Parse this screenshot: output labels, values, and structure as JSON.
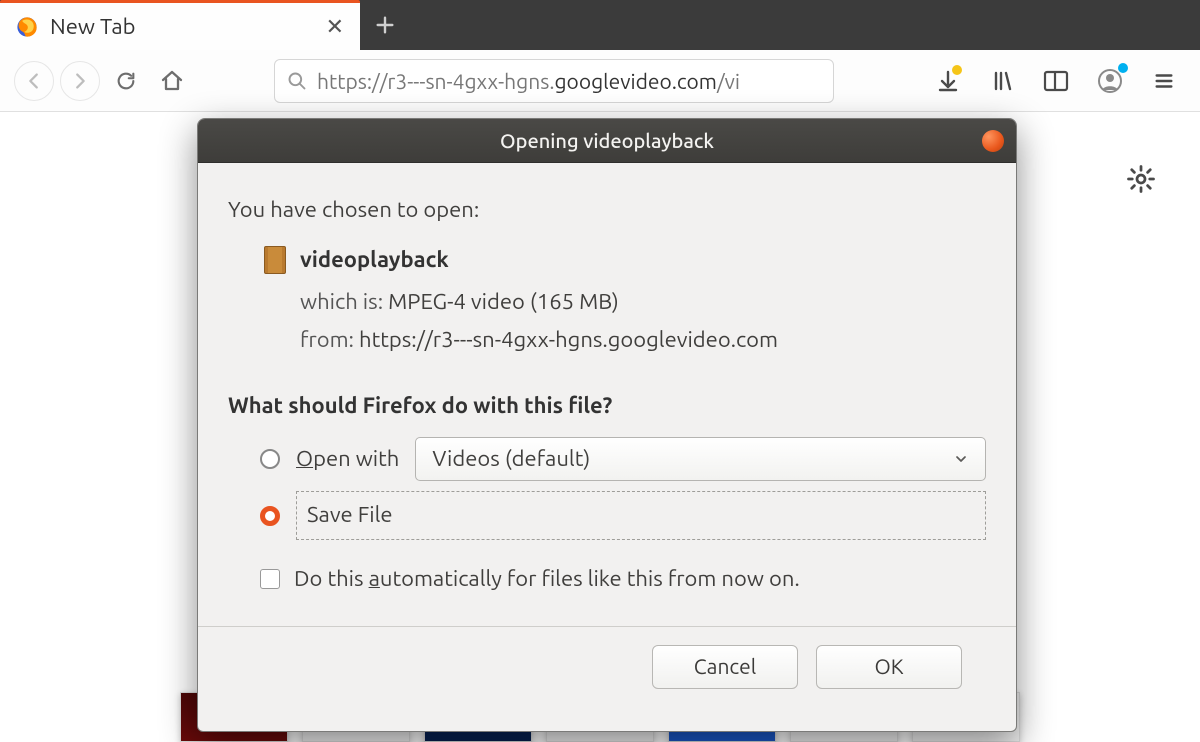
{
  "tab": {
    "title": "New Tab"
  },
  "url": {
    "prefix": "https://r3---sn-4gxx-hgns.",
    "domain": "googlevideo.com",
    "suffix": "/vi"
  },
  "dialog": {
    "title": "Opening videoplayback",
    "intro": "You have chosen to open:",
    "filename": "videoplayback",
    "which_label": "which is:",
    "which_value": "MPEG-4 video (165 MB)",
    "from_label": "from:",
    "from_value": "https://r3---sn-4gxx-hgns.googlevideo.com",
    "question": "What should Firefox do with this file?",
    "open_with_o": "O",
    "open_with_rest": "pen with",
    "open_with_app": "Videos (default)",
    "save_file": "Save File",
    "auto_prefix": "Do this ",
    "auto_a": "a",
    "auto_rest": "utomatically for files like this from now on.",
    "cancel": "Cancel",
    "ok": "OK"
  }
}
